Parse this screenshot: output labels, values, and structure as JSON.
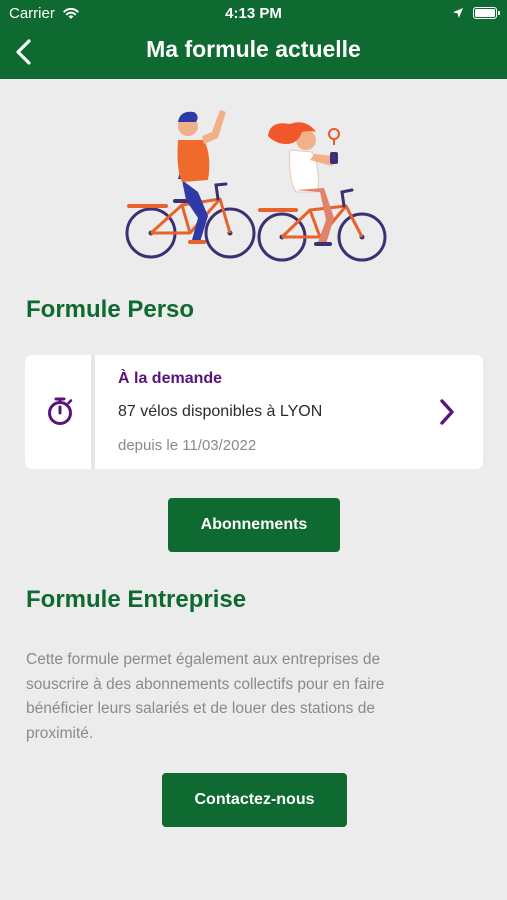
{
  "status_bar": {
    "carrier": "Carrier",
    "time": "4:13 PM"
  },
  "header": {
    "title": "Ma formule actuelle"
  },
  "formule_perso": {
    "heading": "Formule Perso",
    "card": {
      "title": "À la demande",
      "availability": "87 vélos disponibles à LYON",
      "since": "depuis le 11/03/2022"
    },
    "button_label": "Abonnements"
  },
  "formule_entreprise": {
    "heading": "Formule Entreprise",
    "description": "Cette formule permet également aux entreprises de souscrire à des abonnements collectifs pour en faire bénéficier leurs salariés et de louer des stations de proximité.",
    "button_label": "Contactez-nous"
  },
  "icons": {
    "back": "chevron-left-icon",
    "wifi": "wifi-icon",
    "location": "location-arrow-icon",
    "battery": "battery-icon",
    "timer": "stopwatch-icon",
    "card_arrow": "chevron-right-icon"
  },
  "colors": {
    "brand_green": "#0e6a31",
    "accent_purple": "#5a137d",
    "background": "#ececec",
    "text_gray": "#8a8a8a"
  }
}
